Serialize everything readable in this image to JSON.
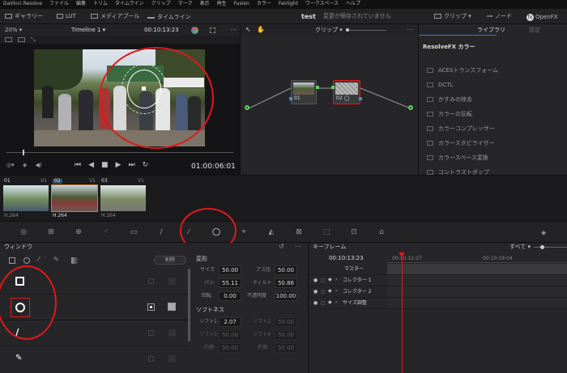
{
  "menubar": {
    "items": [
      "DaVinci Resolve",
      "ファイル",
      "編集",
      "トリム",
      "タイムライン",
      "クリップ",
      "マーク",
      "表示",
      "再生",
      "Fusion",
      "カラー",
      "Fairlight",
      "ワークスペース",
      "ヘルプ"
    ]
  },
  "toolbar": {
    "gallery": "ギャラリー",
    "lut": "LUT",
    "media_pool": "メディアプール",
    "timeline": "タイムライン",
    "project_name": "test",
    "project_status": "変更が保存されていません",
    "clip": "クリップ",
    "node": "ノード",
    "openfx": "OpenFX"
  },
  "viewer": {
    "zoom": "20%",
    "timeline_name": "Timeline 1",
    "timecode_top": "00:10:13:23",
    "timecode": "01:00:06:01"
  },
  "node_editor": {
    "mode": "クリップ",
    "nodes": [
      {
        "label": "01"
      },
      {
        "label": "02"
      }
    ]
  },
  "library": {
    "tab_library": "ライブラリ",
    "tab_settings": "設定",
    "section": "ResolveFX カラー",
    "items": [
      "ACESトランスフォーム",
      "DCTL",
      "かすみの除去",
      "カラーの反転",
      "カラーコンプレッサー",
      "カラースタビライザー",
      "カラースペース変換",
      "コントラストポップ"
    ]
  },
  "clips": [
    {
      "num": "01",
      "track": "V1",
      "codec": "H.264"
    },
    {
      "num": "02",
      "track": "V1",
      "codec": "H.264"
    },
    {
      "num": "03",
      "track": "V1",
      "codec": "H.264"
    }
  ],
  "window_panel": {
    "title": "ウィンドウ",
    "delete": "削除"
  },
  "transform": {
    "title": "変形",
    "size_label": "サイズ",
    "size_value": "50.00",
    "aspect_label": "アス比",
    "aspect_value": "50.00",
    "pan_label": "パン",
    "pan_value": "55.11",
    "tilt_label": "ティルト",
    "tilt_value": "50.86",
    "rotate_label": "回転",
    "rotate_value": "0.00",
    "opacity_label": "不透明度",
    "opacity_value": "100.00"
  },
  "softness": {
    "title": "ソフトネス",
    "s1_label": "ソフト1",
    "s1_value": "2.07",
    "s2_label": "ソフト2",
    "s2_value": "50.00",
    "s3_label": "ソフト3",
    "s3_value": "50.00",
    "s4_label": "ソフト4",
    "s4_value": "50.00",
    "inside_label": "内側",
    "inside_value": "50.00",
    "outside_label": "外側",
    "outside_value": "50.00"
  },
  "keyframes": {
    "title": "キーフレーム",
    "filter": "すべて",
    "timecode": "00:10:13:23",
    "ruler_start": "00:10:12:27",
    "ruler_end": "00:10:19:04",
    "rows": [
      "マスター",
      "コレクター 1",
      "コレクター 2",
      "サイズ調整"
    ]
  },
  "colors": {
    "accent": "#2c7fd0",
    "highlight": "#e0191b",
    "playhead": "#e0191b"
  }
}
